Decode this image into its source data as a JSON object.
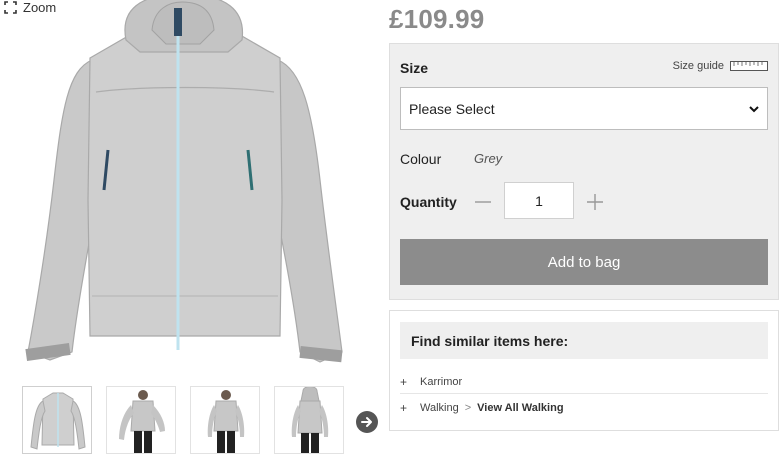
{
  "gallery": {
    "zoom_label": "Zoom",
    "main_image_alt": "Grey hooded jacket",
    "thumbnails": [
      {
        "name": "thumb-front"
      },
      {
        "name": "thumb-model-side"
      },
      {
        "name": "thumb-model-front"
      },
      {
        "name": "thumb-model-back"
      }
    ]
  },
  "product": {
    "price": "£109.99"
  },
  "options": {
    "size_label": "Size",
    "size_guide_label": "Size guide",
    "size_select_value": "Please Select",
    "colour_label": "Colour",
    "colour_value": "Grey",
    "quantity_label": "Quantity",
    "quantity_value": "1",
    "add_to_bag_label": "Add to bag"
  },
  "similar": {
    "heading": "Find similar items here:",
    "rows": [
      {
        "bullet": "+",
        "items": [
          "Karrimor"
        ]
      },
      {
        "bullet": "+",
        "items": [
          "Walking",
          "View All Walking"
        ],
        "separator": ">"
      }
    ]
  },
  "colors": {
    "price": "#8a8a8a",
    "panel_bg": "#efefef",
    "button_bg": "#8c8c8c"
  }
}
